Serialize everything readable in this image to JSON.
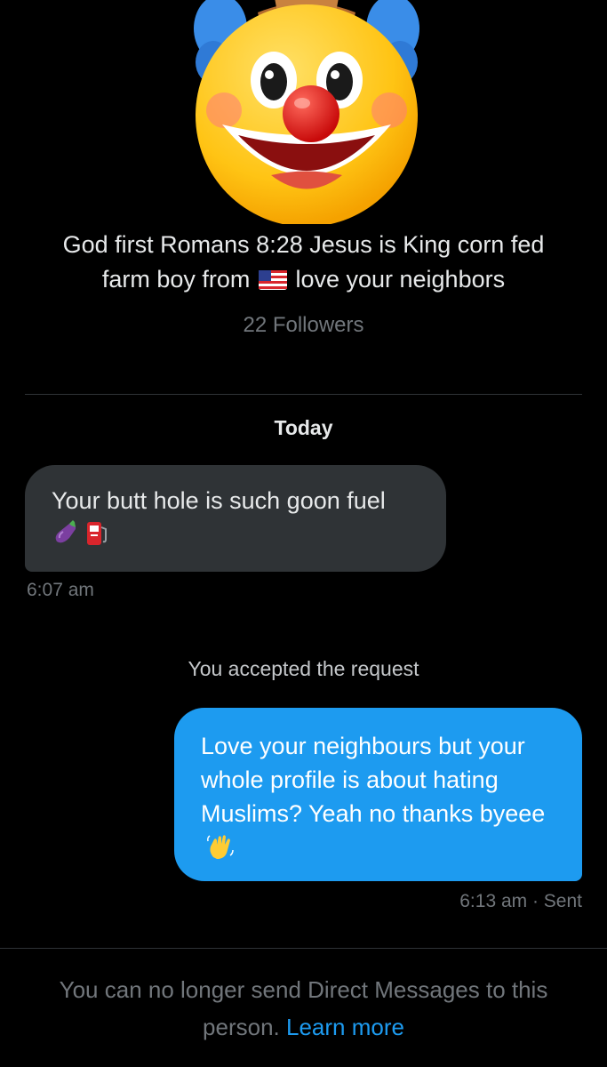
{
  "profile": {
    "avatar_icon": "clown-cowboy-emoji-icon",
    "bio_before_flag": "God first Romans 8:28 Jesus is King corn fed farm boy from",
    "flag_icon": "us-flag-icon",
    "bio_after_flag": "love your neighbors",
    "followers": "22 Followers"
  },
  "conversation": {
    "date_separator": "Today",
    "incoming_message": {
      "text": "Your butt hole is such goon fuel",
      "emojis": [
        "eggplant-icon",
        "fuel-pump-icon"
      ],
      "time": "6:07 am"
    },
    "system_message": "You accepted the request",
    "outgoing_message": {
      "text": "Love your neighbours but your whole profile is about hating Muslims? Yeah no thanks byeee",
      "emoji": "waving-hand-icon",
      "status": "6:13 am · Sent"
    }
  },
  "footer": {
    "notice": "You can no longer send Direct Messages to this person.",
    "link": "Learn more"
  },
  "colors": {
    "background": "#000000",
    "incoming_bubble": "#2f3336",
    "outgoing_bubble": "#1d9bf0",
    "muted_text": "#71767b",
    "link": "#1d9bf0"
  }
}
